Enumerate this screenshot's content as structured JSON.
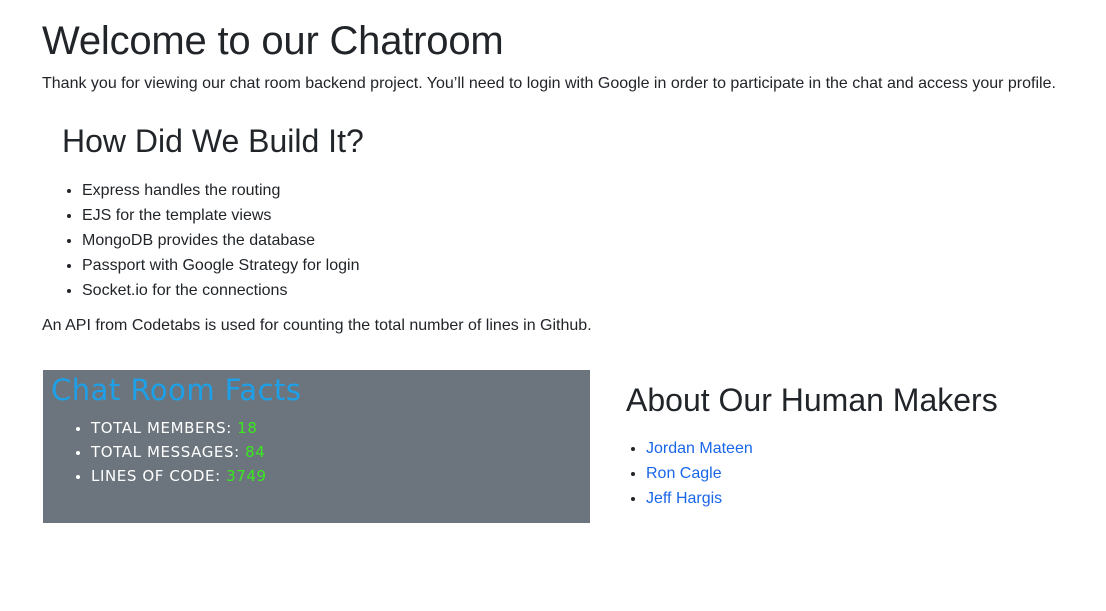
{
  "header": {
    "title": "Welcome to our Chatroom",
    "intro": "Thank you for viewing our chat room backend project. You’ll need to login with Google in order to participate in the chat and access your profile."
  },
  "build": {
    "title": "How Did We Build It?",
    "items": [
      "Express handles the routing",
      "EJS for the template views",
      "MongoDB provides the database",
      "Passport with Google Strategy for login",
      "Socket.io for the connections"
    ],
    "api_note": "An API from Codetabs is used for counting the total number of lines in Github."
  },
  "facts": {
    "title": "Chat Room Facts",
    "members_label": "TOTAL MEMBERS:",
    "members_value": "18",
    "messages_label": "TOTAL MESSAGES:",
    "messages_value": "84",
    "lines_label": "LINES OF CODE:",
    "lines_value": "3749",
    "colors": {
      "panel": "#6c757d",
      "title": "#1ea0e8",
      "count": "#39e81e"
    }
  },
  "makers": {
    "title": "About Our Human Makers",
    "people": [
      "Jordan Mateen",
      "Ron Cagle",
      "Jeff Hargis"
    ],
    "link_color": "#1a66e8"
  }
}
